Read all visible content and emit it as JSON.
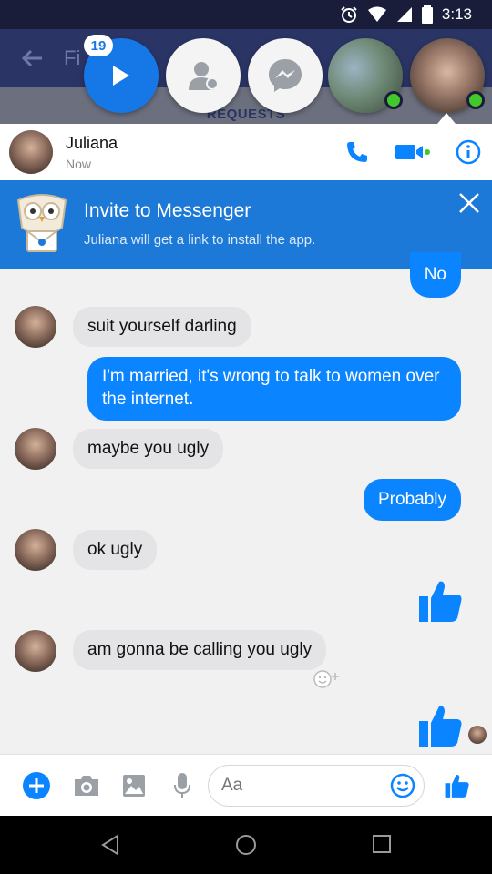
{
  "status_bar": {
    "time": "3:13"
  },
  "background": {
    "title": "Fi",
    "tab_label": "REQUESTS"
  },
  "chat_heads": {
    "badge_count": "19"
  },
  "conversation": {
    "contact_name": "Juliana",
    "contact_status": "Now"
  },
  "invite_banner": {
    "title": "Invite to Messenger",
    "subtitle": "Juliana will get a link to install the app."
  },
  "messages": [
    {
      "from": "me",
      "text": "No"
    },
    {
      "from": "them",
      "text": "suit yourself darling"
    },
    {
      "from": "me",
      "text": "I'm married, it's wrong to talk to women over the internet."
    },
    {
      "from": "them",
      "text": "maybe you ugly"
    },
    {
      "from": "me",
      "text": "Probably"
    },
    {
      "from": "them",
      "text": "ok ugly"
    },
    {
      "from": "me",
      "type": "like"
    },
    {
      "from": "them",
      "text": "am gonna be calling you ugly"
    },
    {
      "from": "me",
      "type": "like"
    }
  ],
  "composer": {
    "placeholder": "Aa"
  },
  "colors": {
    "accent": "#0a84ff",
    "banner": "#1d79d7",
    "incoming_bubble": "#e4e4e6",
    "online": "#42c72c"
  }
}
